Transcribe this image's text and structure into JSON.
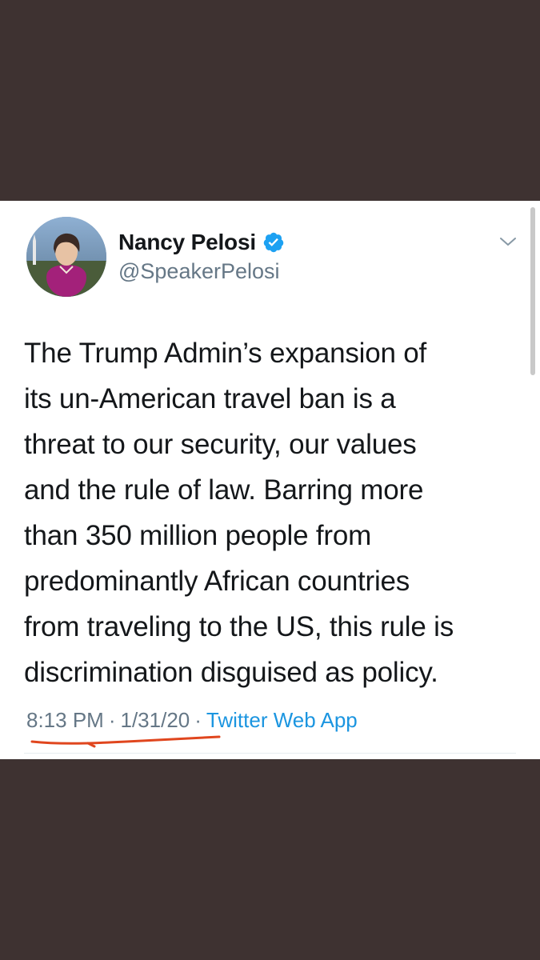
{
  "tweet": {
    "author": {
      "display_name": "Nancy Pelosi",
      "handle": "@SpeakerPelosi",
      "verified": true,
      "avatar_icon": "profile-photo"
    },
    "text": "The Trump Admin’s expansion of\nits un-American travel ban is a\nthreat to our security, our values\nand the rule of law. Barring more\nthan 350 million people from\npredominantly African countries\nfrom traveling to the US, this rule is\ndiscrimination disguised as policy.",
    "time": "8:13 PM",
    "date": "1/31/20",
    "separator": "·",
    "source": "Twitter Web App"
  },
  "colors": {
    "background": "#3e3231",
    "card": "#ffffff",
    "verified_blue": "#1da1f2",
    "link_blue": "#1b95e0",
    "muted_text": "#657786",
    "underline_annotation": "#e0461e"
  },
  "icons": {
    "verified": "verified-badge-icon",
    "menu": "chevron-down-icon"
  }
}
